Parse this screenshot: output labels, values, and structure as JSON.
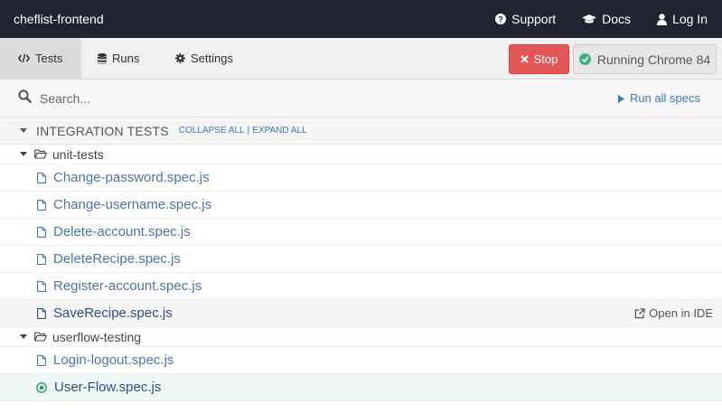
{
  "app": {
    "name": "cheflist-frontend"
  },
  "top_nav": {
    "support": "Support",
    "docs": "Docs",
    "login": "Log In"
  },
  "tabs": [
    {
      "label": "Tests",
      "icon": "code-icon",
      "active": true
    },
    {
      "label": "Runs",
      "icon": "database-icon",
      "active": false
    },
    {
      "label": "Settings",
      "icon": "gear-icon",
      "active": false
    }
  ],
  "controls": {
    "stop_label": "Stop",
    "browser_label": "Running Chrome 84"
  },
  "search": {
    "placeholder": "Search...",
    "value": "",
    "run_all_label": "Run all specs"
  },
  "integration": {
    "title": "INTEGRATION TESTS",
    "collapse_all": "COLLAPSE ALL",
    "separator": "|",
    "expand_all": "EXPAND ALL"
  },
  "folders": [
    {
      "name": "unit-tests",
      "files": [
        "Change-password.spec.js",
        "Change-username.spec.js",
        "Delete-account.spec.js",
        "DeleteRecipe.spec.js",
        "Register-account.spec.js",
        "SaveRecipe.spec.js"
      ]
    },
    {
      "name": "userflow-testing",
      "files": [
        "Login-logout.spec.js",
        "User-Flow.spec.js"
      ]
    }
  ],
  "hovered_file": "SaveRecipe.spec.js",
  "running_file": "User-Flow.spec.js",
  "open_in_ide_label": "Open in IDE",
  "colors": {
    "topbar": "#21242e",
    "link_blue": "#3b78c2",
    "stop_red": "#e35757",
    "running_green": "#3fb27f"
  }
}
